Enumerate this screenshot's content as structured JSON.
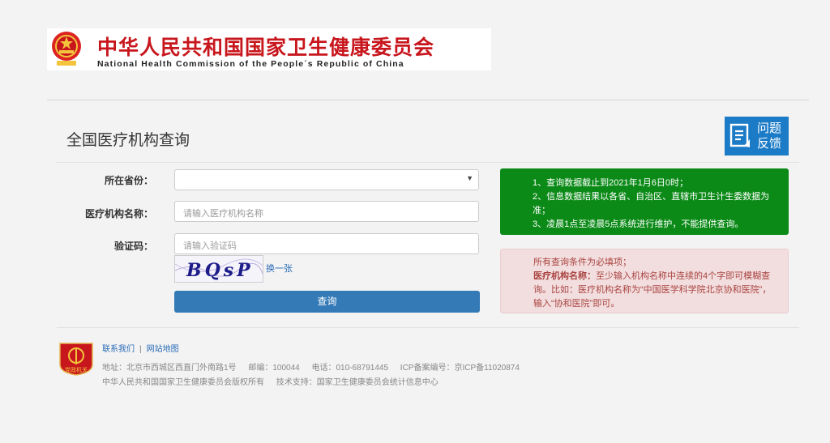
{
  "header": {
    "title_cn": "中华人民共和国国家卫生健康委员会",
    "title_en": "National Health Commission of the People´s Republic of China"
  },
  "page": {
    "title": "全国医疗机构查询",
    "feedback_line1": "问题",
    "feedback_line2": "反馈"
  },
  "form": {
    "province_label": "所在省份：",
    "province_value": "",
    "name_label": "医疗机构名称：",
    "name_placeholder": "请输入医疗机构名称",
    "captcha_label": "验证码：",
    "captcha_placeholder": "请输入验证码",
    "captcha_text": "BQsP",
    "captcha_refresh": "换一张",
    "submit_label": "查询"
  },
  "notice": {
    "items": [
      "1、查询数据截止到2021年1月6日0时；",
      "2、信息数据结果以各省、自治区、直辖市卫生计生委数据为准；",
      "3、凌晨1点至凌晨5点系统进行维护，不能提供查询。"
    ],
    "required_line": "所有查询条件为必填项；",
    "tip_label": "医疗机构名称：",
    "tip_text": "至少输入机构名称中连续的4个字即可模糊查询。比如：医疗机构名称为“中国医学科学院北京协和医院”，输入“协和医院”即可。"
  },
  "footer": {
    "link_contact": "联系我们",
    "link_sitemap": "网站地图",
    "separator": "|",
    "address": "地址：北京市西城区西直门外南路1号",
    "postcode": "邮编：100044",
    "phone": "电话：010-68791445",
    "icp": "ICP备案编号：京ICP备11020874",
    "copyright": "中华人民共和国国家卫生健康委员会版权所有",
    "support": "技术支持：国家卫生健康委员会统计信息中心",
    "badge_text": "党政机关"
  },
  "colors": {
    "brand_red": "#c8161d",
    "primary_blue": "#337ab7",
    "notice_green": "#0b8a17",
    "notice_red_bg": "#f2dede"
  }
}
